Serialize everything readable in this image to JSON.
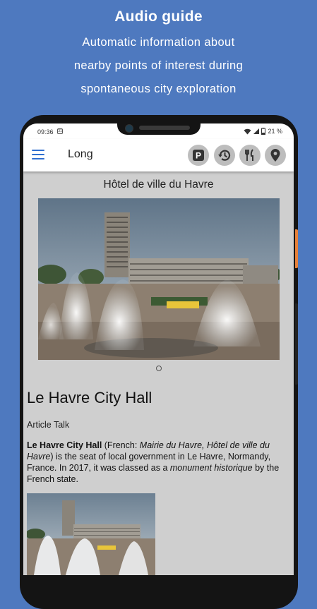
{
  "promo": {
    "title": "Audio guide",
    "line1": "Automatic information about",
    "line2": "nearby points of interest during",
    "line3": "spontaneous city exploration"
  },
  "statusbar": {
    "time": "09:36",
    "notif": "31",
    "battery": "21 %"
  },
  "appbar": {
    "title": "Long",
    "parking_label": "P",
    "icons": [
      "menu-icon",
      "parking-icon",
      "history-icon",
      "restaurant-icon",
      "location-pin-icon"
    ]
  },
  "place": {
    "title": "Hôtel de ville du Havre"
  },
  "article": {
    "title": "Le Havre City Hall",
    "tabs": "Article Talk",
    "p_bold": "Le Havre City Hall",
    "p_1": " (French: ",
    "p_it1": "Mairie du Havre, Hôtel de ville du Havre",
    "p_2": ") is the seat of local government in Le Havre, Normandy, France. In 2017, it was classed as a ",
    "p_it2": "monument historique",
    "p_3": " by the French state."
  },
  "colors": {
    "background": "#4e79bf",
    "accent": "#2f6fd0",
    "screen": "#cfcfcf",
    "icon_button": "#bdbdbd"
  }
}
